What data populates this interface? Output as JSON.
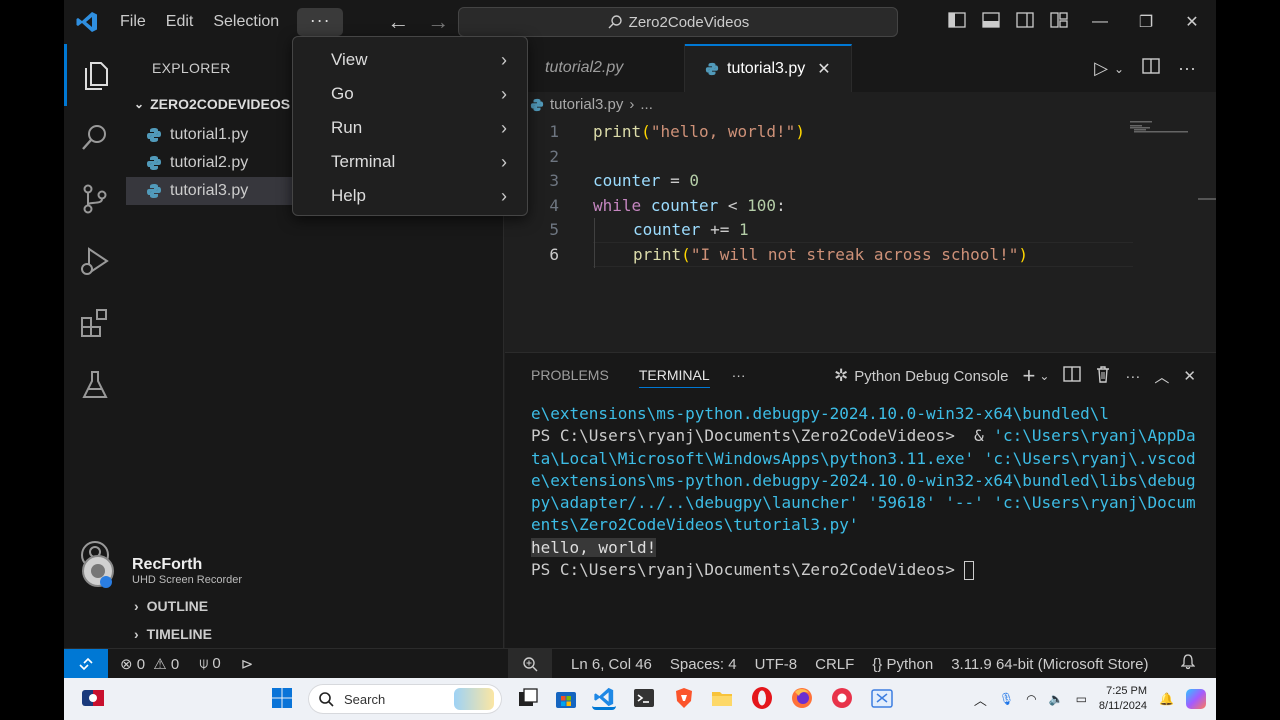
{
  "titlebar": {
    "menus": [
      "File",
      "Edit",
      "Selection"
    ],
    "more": "···",
    "search_label": "Zero2CodeVideos"
  },
  "dropdown": {
    "items": [
      {
        "label": "View"
      },
      {
        "label": "Go"
      },
      {
        "label": "Run"
      },
      {
        "label": "Terminal"
      },
      {
        "label": "Help"
      }
    ]
  },
  "sidebar": {
    "title": "EXPLORER",
    "folder": "ZERO2CODEVIDEOS",
    "files": [
      "tutorial1.py",
      "tutorial2.py",
      "tutorial3.py"
    ],
    "outline": "OUTLINE",
    "timeline": "TIMELINE",
    "recorder_name": "RecForth",
    "recorder_sub": "UHD Screen Recorder"
  },
  "editor": {
    "tabs": [
      "tutorial2.py",
      "tutorial3.py"
    ],
    "breadcrumb_file": "tutorial3.py",
    "breadcrumb_more": "...",
    "line_numbers": [
      "1",
      "2",
      "3",
      "4",
      "5",
      "6"
    ],
    "code": {
      "l1_fn": "print",
      "l1_str": "\"hello, world!\"",
      "l3_var": "counter",
      "l3_op": " = ",
      "l3_num": "0",
      "l4_kw": "while",
      "l4_var": "counter",
      "l4_op": " < ",
      "l4_num": "100",
      "l4_colon": ":",
      "l5_var": "counter",
      "l5_op": " += ",
      "l5_num": "1",
      "l6_fn": "print",
      "l6_str": "\"I will not streak across school!\""
    }
  },
  "panel": {
    "tabs": [
      "PROBLEMS",
      "TERMINAL"
    ],
    "more": "···",
    "console_label": "Python Debug Console",
    "terminal": {
      "l1": "e\\extensions\\ms-python.debugpy-2024.10.0-win32-x64\\bundled\\l",
      "l2_ps": "PS C:\\Users\\ryanj\\Documents\\Zero2CodeVideos>  & ",
      "l2_path": "'c:\\Users\\ryanj\\AppDa",
      "l3": "ta\\Local\\Microsoft\\WindowsApps\\python3.11.exe' 'c:\\Users\\ryanj\\.vscod",
      "l4": "e\\extensions\\ms-python.debugpy-2024.10.0-win32-x64\\bundled\\libs\\debug",
      "l5": "py\\adapter/../..\\debugpy\\launcher' '59618' '--' 'c:\\Users\\ryanj\\Docum",
      "l6": "ents\\Zero2CodeVideos\\tutorial3.py'",
      "l7": "hello, world!",
      "l8": "PS C:\\Users\\ryanj\\Documents\\Zero2CodeVideos> "
    }
  },
  "statusbar": {
    "errors": "0",
    "warnings": "0",
    "ports": "0",
    "position": "Ln 6, Col 46",
    "spaces": "Spaces: 4",
    "encoding": "UTF-8",
    "eol": "CRLF",
    "language": "Python",
    "interpreter": "3.11.9 64-bit (Microsoft Store)"
  },
  "taskbar": {
    "search": "Search",
    "time": "7:25 PM",
    "date": "8/11/2024"
  },
  "colors": {
    "accent": "#0078d4",
    "terminal_path": "#3dbde6",
    "string": "#ce9178",
    "keyword": "#c586c0"
  }
}
